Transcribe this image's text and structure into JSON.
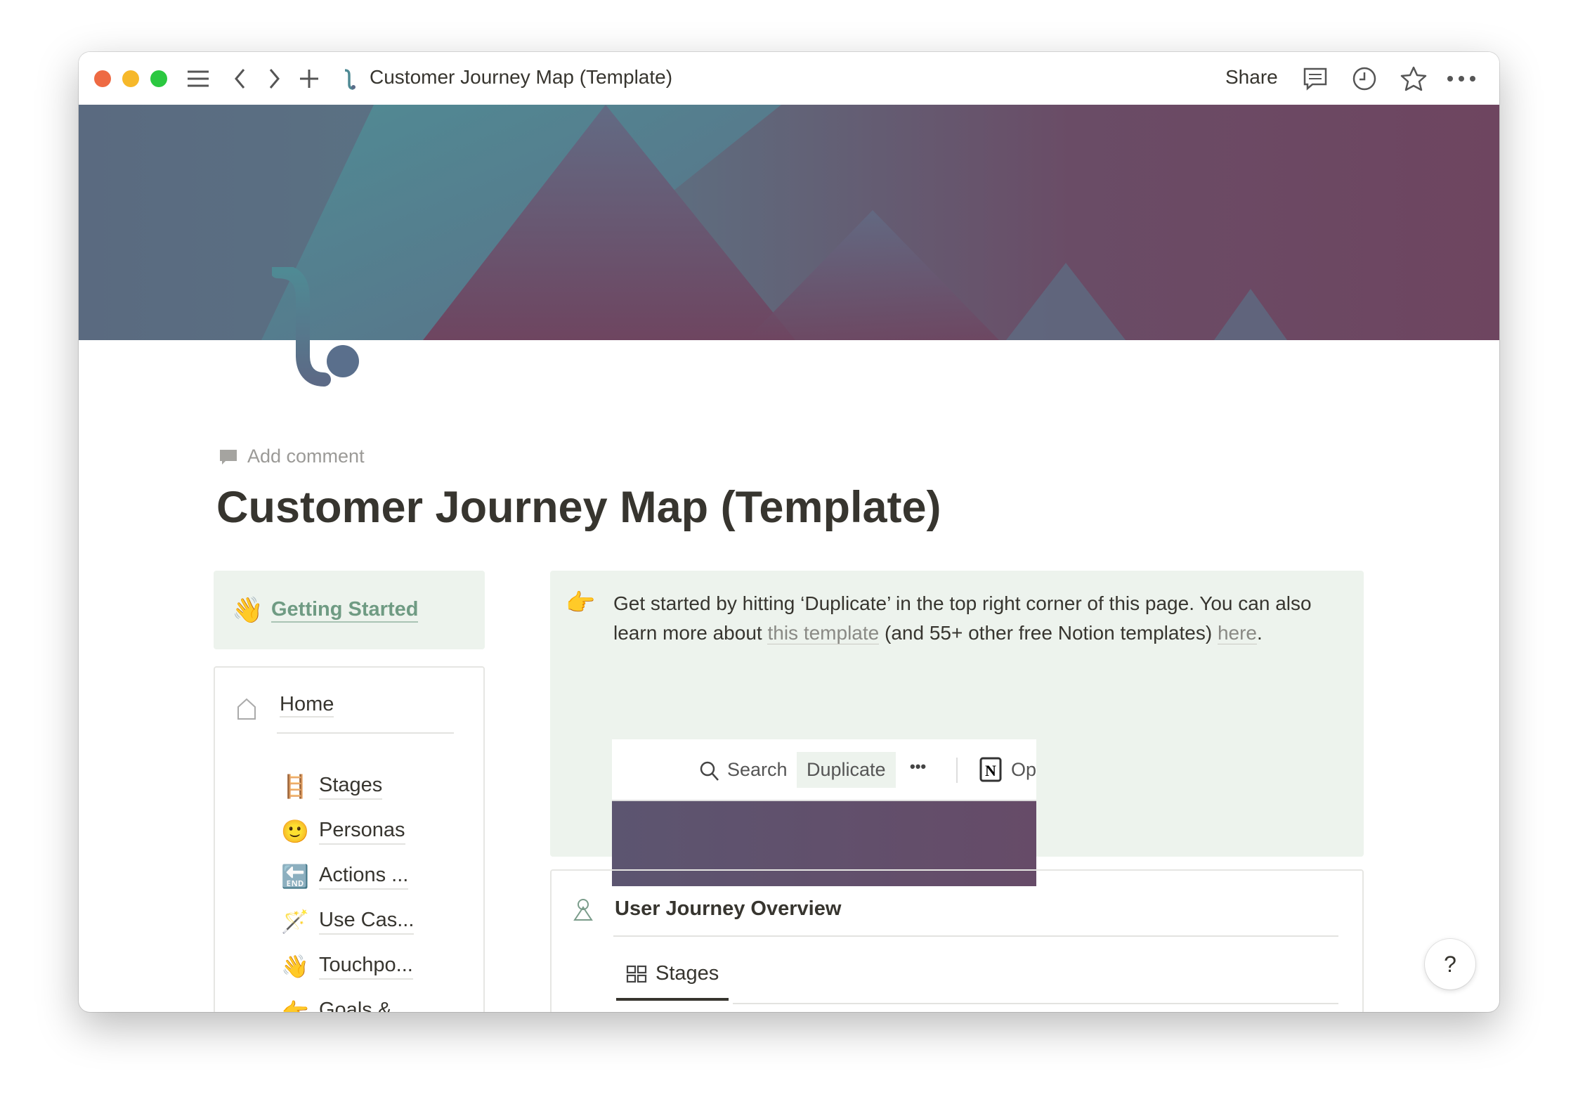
{
  "window": {
    "title": "Customer Journey Map (Template)",
    "share_label": "Share",
    "icons": [
      "sidebar-menu-icon",
      "back-icon",
      "forward-icon",
      "new-page-icon",
      "comment-icon",
      "history-icon",
      "favorite-star-icon",
      "more-icon"
    ]
  },
  "page": {
    "add_comment": "Add comment",
    "title": "Customer Journey Map (Template)",
    "getting_started": {
      "emoji": "👋",
      "label": "Getting Started"
    },
    "nav": {
      "home": "Home",
      "items": [
        {
          "emoji": "🪜",
          "label": "Stages"
        },
        {
          "emoji": "🙂",
          "label": "Personas"
        },
        {
          "emoji": "🔚",
          "label": "Actions ..."
        },
        {
          "emoji": "🪄",
          "label": "Use Cas..."
        },
        {
          "emoji": "👋",
          "label": "Touchpo..."
        },
        {
          "emoji": "👉",
          "label": "Goals & ..."
        }
      ]
    },
    "callout": {
      "emoji": "👉",
      "text_1": "Get started by hitting ‘Duplicate’ in the top right corner of this page. You can also learn more about ",
      "link_1": "this template",
      "text_2": " (and 55+ other free Notion templates) ",
      "link_2": "here",
      "text_3": "."
    },
    "preview": {
      "search": "Search",
      "duplicate": "Duplicate",
      "more": "•••",
      "open": "Op"
    },
    "overview": {
      "title": "User Journey Overview",
      "tab": "Stages"
    },
    "help": "?"
  },
  "colors": {
    "callout_bg": "#edf3ed",
    "link_green": "#6f9b83",
    "banner_teal": "#4f8a94",
    "banner_plum": "#6e4560"
  }
}
